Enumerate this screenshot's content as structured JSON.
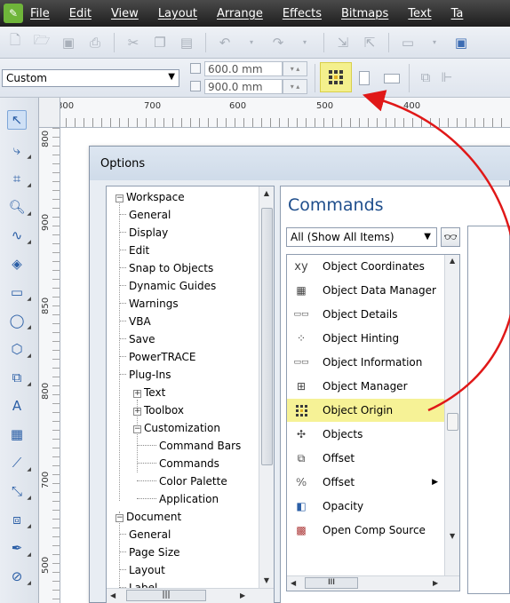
{
  "menu": [
    "File",
    "Edit",
    "View",
    "Layout",
    "Arrange",
    "Effects",
    "Bitmaps",
    "Text",
    "Ta"
  ],
  "property_bar": {
    "preset": "Custom",
    "width": "600.0 mm",
    "height": "900.0 mm"
  },
  "ruler": {
    "h_labels": [
      "800",
      "700",
      "600",
      "500",
      "400"
    ],
    "v_labels": [
      "800",
      "900",
      "850",
      "800",
      "750",
      "700",
      "650",
      "600",
      "550",
      "500"
    ]
  },
  "dialog": {
    "title": "Options",
    "tree": [
      {
        "label": "Workspace",
        "level": 0,
        "expander": "−"
      },
      {
        "label": "General",
        "level": 1
      },
      {
        "label": "Display",
        "level": 1
      },
      {
        "label": "Edit",
        "level": 1
      },
      {
        "label": "Snap to Objects",
        "level": 1
      },
      {
        "label": "Dynamic Guides",
        "level": 1
      },
      {
        "label": "Warnings",
        "level": 1
      },
      {
        "label": "VBA",
        "level": 1
      },
      {
        "label": "Save",
        "level": 1
      },
      {
        "label": "PowerTRACE",
        "level": 1
      },
      {
        "label": "Plug-Ins",
        "level": 1
      },
      {
        "label": "Text",
        "level": 1,
        "expander": "+"
      },
      {
        "label": "Toolbox",
        "level": 1,
        "expander": "+"
      },
      {
        "label": "Customization",
        "level": 1,
        "expander": "−"
      },
      {
        "label": "Command Bars",
        "level": 2
      },
      {
        "label": "Commands",
        "level": 2,
        "selected": true
      },
      {
        "label": "Color Palette",
        "level": 2
      },
      {
        "label": "Application",
        "level": 2
      },
      {
        "label": "Document",
        "level": 0,
        "expander": "−"
      },
      {
        "label": "General",
        "level": 1
      },
      {
        "label": "Page Size",
        "level": 1
      },
      {
        "label": "Layout",
        "level": 1
      },
      {
        "label": "Label",
        "level": 1
      }
    ],
    "commands": {
      "heading": "Commands",
      "filter": "All (Show All Items)",
      "items": [
        {
          "label": "Object Coordinates",
          "icon": "xy-icon"
        },
        {
          "label": "Object Data Manager",
          "icon": "data-manager-icon"
        },
        {
          "label": "Object Details",
          "icon": "details-icon"
        },
        {
          "label": "Object Hinting",
          "icon": "hinting-icon"
        },
        {
          "label": "Object Information",
          "icon": "information-icon"
        },
        {
          "label": "Object Manager",
          "icon": "object-manager-icon"
        },
        {
          "label": "Object Origin",
          "icon": "object-origin-icon",
          "highlight": true
        },
        {
          "label": "Objects",
          "icon": "objects-icon"
        },
        {
          "label": "Offset",
          "icon": "offset-icon"
        },
        {
          "label": "Offset",
          "icon": "offset-flyout-icon",
          "submenu": true
        },
        {
          "label": "Opacity",
          "icon": "opacity-icon"
        },
        {
          "label": "Open Comp Source",
          "icon": "comp-source-icon"
        }
      ],
      "hscroll_label": "III"
    }
  },
  "colors": {
    "highlight": "#f6f296",
    "arrow": "#e01818",
    "heading": "#1f4e8c"
  }
}
